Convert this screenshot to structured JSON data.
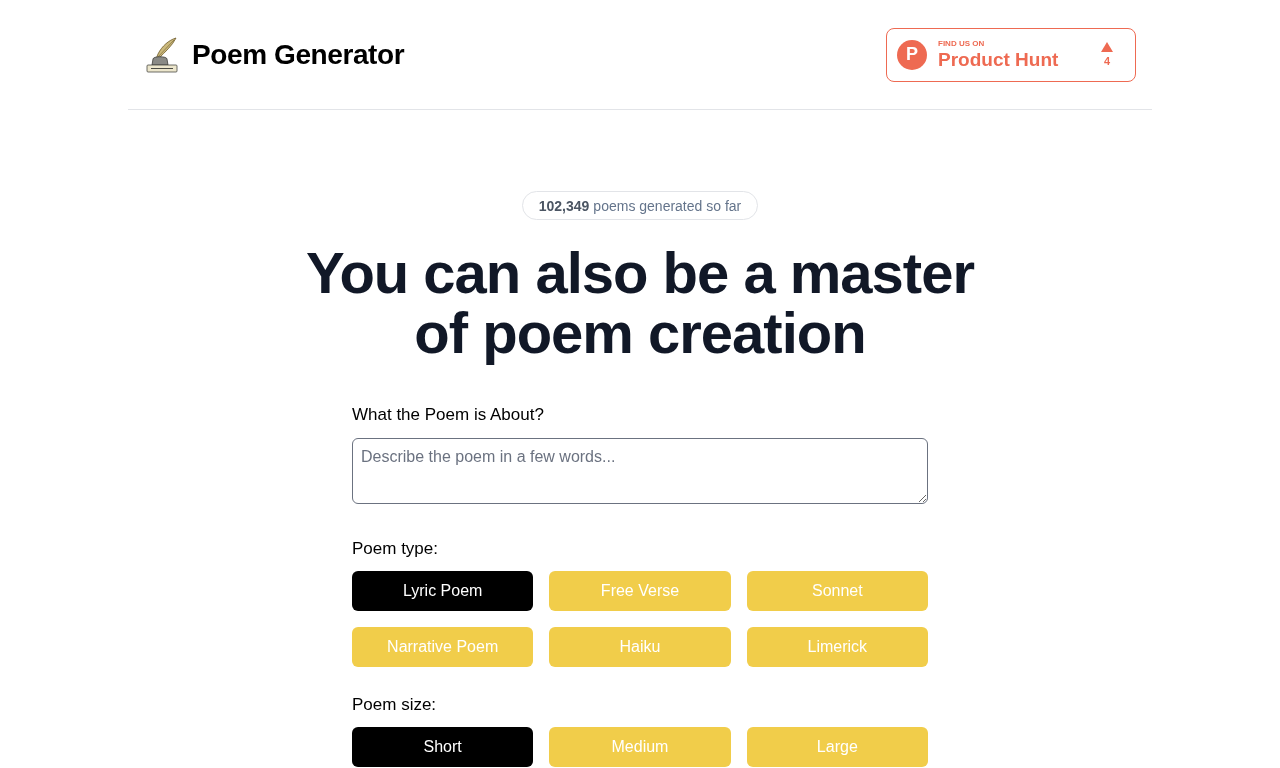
{
  "header": {
    "title": "Poem Generator",
    "product_hunt": {
      "logo_letter": "P",
      "kicker": "FIND US ON",
      "name": "Product Hunt",
      "votes": "4"
    }
  },
  "counter": "**102,349** poems generated so far",
  "headline": "You can also be a master of poem creation",
  "form": {
    "about": {
      "label": "What the Poem is About?",
      "placeholder": "Describe the poem in a few words..."
    },
    "type": {
      "label": "Poem type:",
      "options": [
        {
          "label": "Lyric Poem",
          "selected": true
        },
        {
          "label": "Free Verse",
          "selected": false
        },
        {
          "label": "Sonnet",
          "selected": false
        },
        {
          "label": "Narrative Poem",
          "selected": false
        },
        {
          "label": "Haiku",
          "selected": false
        },
        {
          "label": "Limerick",
          "selected": false
        }
      ]
    },
    "size": {
      "label": "Poem size:",
      "options": [
        {
          "label": "Short",
          "selected": true
        },
        {
          "label": "Medium",
          "selected": false
        },
        {
          "label": "Large",
          "selected": false
        }
      ]
    }
  }
}
